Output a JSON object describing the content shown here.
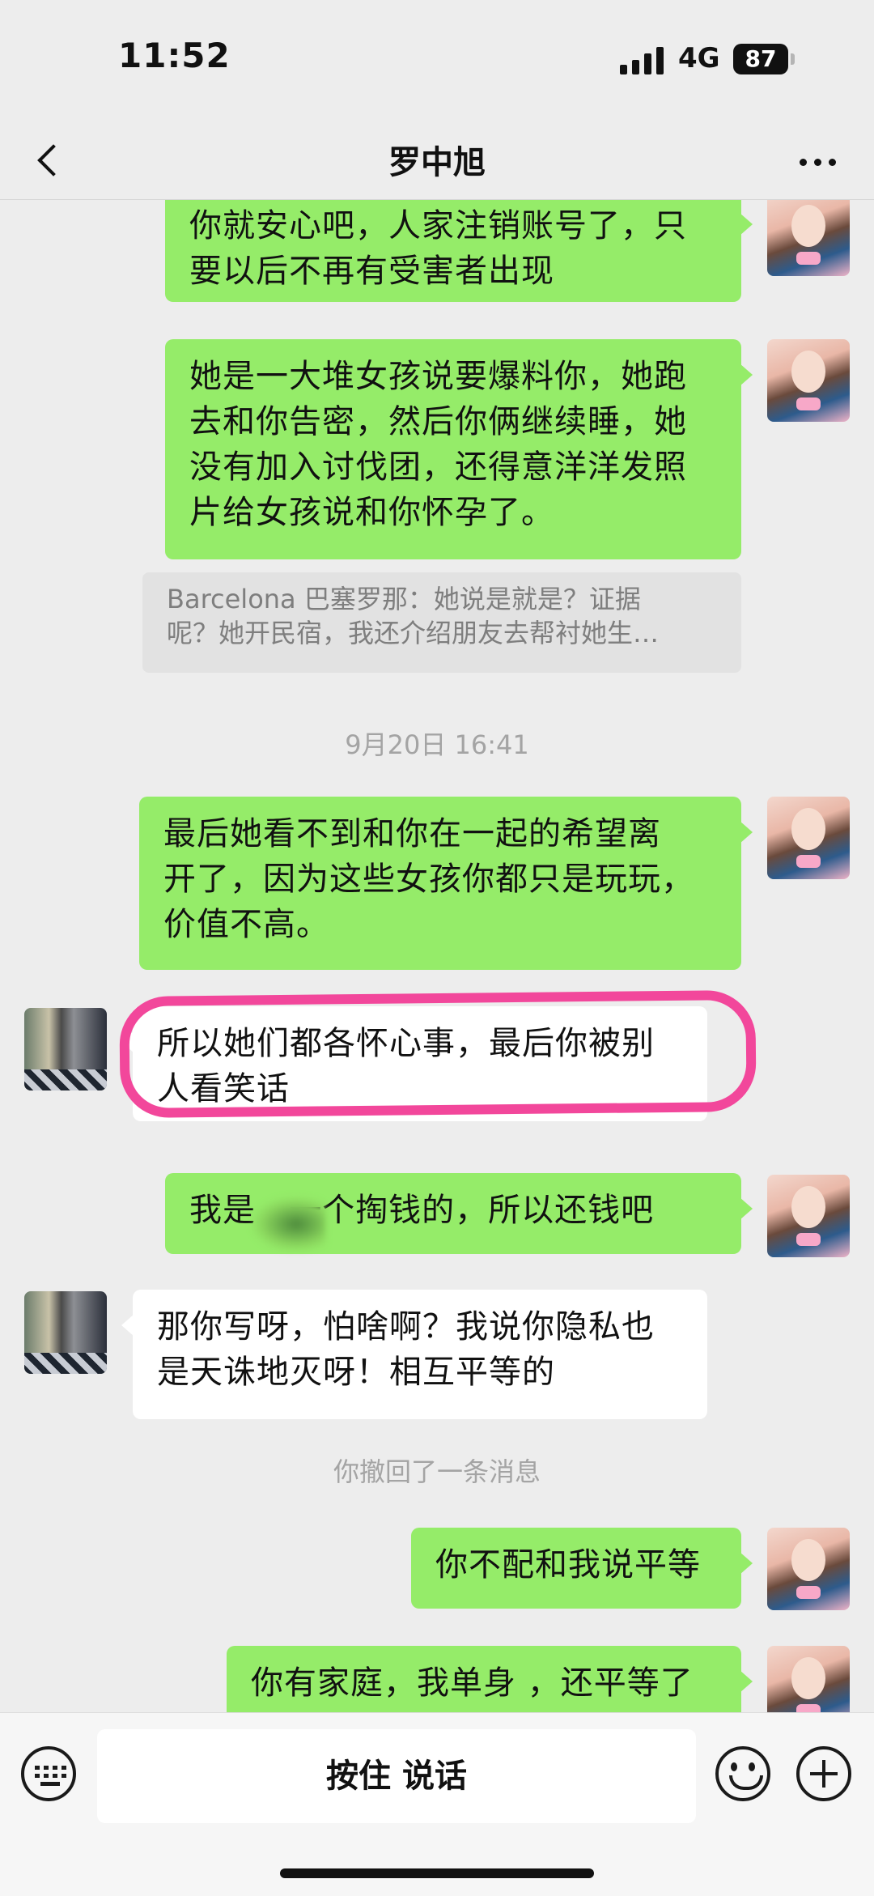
{
  "status_bar": {
    "time": "11:52",
    "network": "4G",
    "battery": "87"
  },
  "header": {
    "title": "罗中旭"
  },
  "messages": [
    {
      "sender": "me",
      "text": "你就安心吧，人家注销账号了，只\n要以后不再有受害者出现"
    },
    {
      "sender": "me",
      "text": "她是一大堆女孩说要爆料你，她跑\n去和你告密，然后你俩继续睡，她\n没有加入讨伐团，还得意洋洋发照\n片给女孩说和你怀孕了。"
    },
    {
      "sender": "me",
      "text": "最后她看不到和你在一起的希望离\n开了，因为这些女孩你都只是玩玩，\n价值不高。"
    },
    {
      "sender": "other",
      "text": "所以她们都各怀心事，最后你被别\n人看笑话"
    },
    {
      "sender": "me",
      "text": "我是   一个掏钱的，所以还钱吧"
    },
    {
      "sender": "other",
      "text": "那你写呀，怕啥啊？我说你隐私也\n是天诛地灭呀！相互平等的"
    },
    {
      "sender": "me",
      "text": "你不配和我说平等"
    },
    {
      "sender": "me",
      "text": "你有家庭，我单身 ，还平等了"
    }
  ],
  "quote": {
    "text": "Barcelona 巴塞罗那：她说是就是？证据\n呢？她开民宿，我还介绍朋友去帮衬她生…"
  },
  "timestamp": "9月20日 16:41",
  "system_notice": "你撤回了一条消息",
  "input_bar": {
    "voice_label": "按住 说话"
  },
  "icons": [
    "back-icon",
    "more-icon",
    "keyboard-icon",
    "emoji-icon",
    "plus-icon"
  ],
  "colors": {
    "outgoing_bubble": "#95ec69",
    "incoming_bubble": "#ffffff",
    "highlight": "#f2479b",
    "background": "#ededed"
  }
}
